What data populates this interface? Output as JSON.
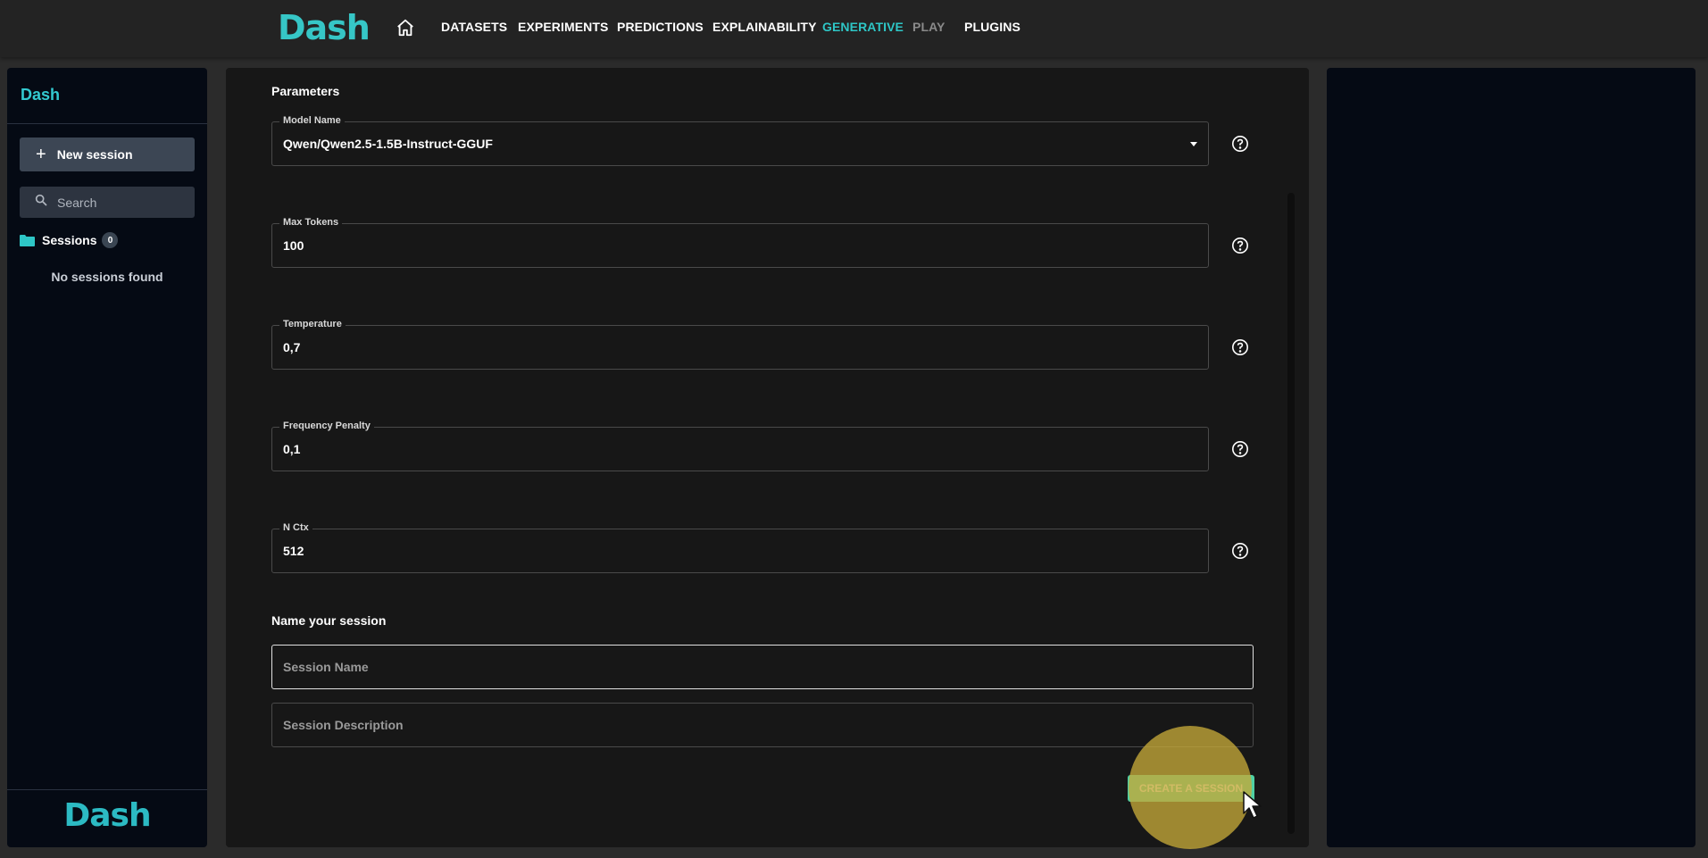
{
  "app": {
    "logo_text": "Dash",
    "nav": {
      "home_icon": "home-icon",
      "items": [
        {
          "label": "DATASETS",
          "state": "normal"
        },
        {
          "label": "EXPERIMENTS",
          "state": "normal"
        },
        {
          "label": "PREDICTIONS",
          "state": "normal"
        },
        {
          "label": "EXPLAINABILITY",
          "state": "normal"
        },
        {
          "label": "GENERATIVE",
          "state": "active"
        },
        {
          "label": "PLAY",
          "state": "disabled"
        },
        {
          "label": "PLUGINS",
          "state": "normal"
        }
      ]
    },
    "accent_color": "#2ec6c6"
  },
  "sidebar": {
    "title": "Dash",
    "new_session_label": "New session",
    "search_placeholder": "Search",
    "sessions_label": "Sessions",
    "sessions_count": "0",
    "empty_text": "No sessions found",
    "footer_logo": "Dash"
  },
  "main": {
    "parameters_title": "Parameters",
    "fields": [
      {
        "label": "Model Name",
        "value": "Qwen/Qwen2.5-1.5B-Instruct-GGUF",
        "type": "select"
      },
      {
        "label": "Max Tokens",
        "value": "100",
        "type": "text"
      },
      {
        "label": "Temperature",
        "value": "0,7",
        "type": "text"
      },
      {
        "label": "Frequency Penalty",
        "value": "0,1",
        "type": "text"
      },
      {
        "label": "N Ctx",
        "value": "512",
        "type": "text"
      }
    ],
    "name_section_title": "Name your session",
    "session_name_placeholder": "Session Name",
    "session_description_placeholder": "Session Description",
    "create_button_label": "CREATE A SESSION"
  }
}
